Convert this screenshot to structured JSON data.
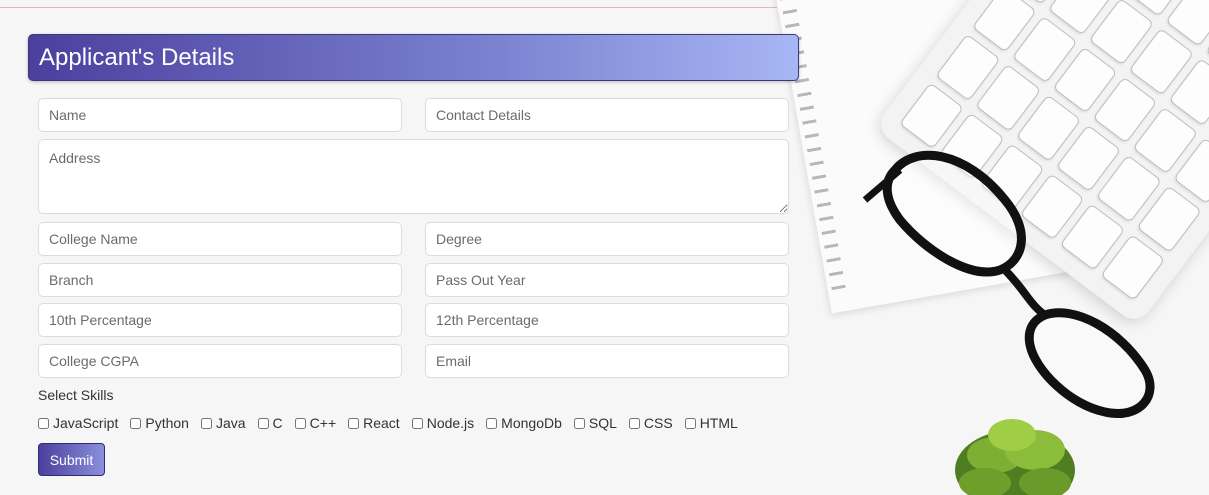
{
  "form": {
    "title": "Applicant's Details",
    "fields": {
      "name": "Name",
      "contact": "Contact Details",
      "address": "Address",
      "college_name": "College Name",
      "degree": "Degree",
      "branch": "Branch",
      "pass_out_year": "Pass Out Year",
      "tenth": "10th Percentage",
      "twelfth": "12th Percentage",
      "cgpa": "College CGPA",
      "email": "Email"
    },
    "skills_label": "Select Skills",
    "skills": [
      "JavaScript",
      "Python",
      "Java",
      "C",
      "C++",
      "React",
      "Node.js",
      "MongoDb",
      "SQL",
      "CSS",
      "HTML"
    ],
    "submit_label": "Submit"
  },
  "colors": {
    "header_start": "#4c3f9e",
    "header_end": "#a7b6f4"
  }
}
